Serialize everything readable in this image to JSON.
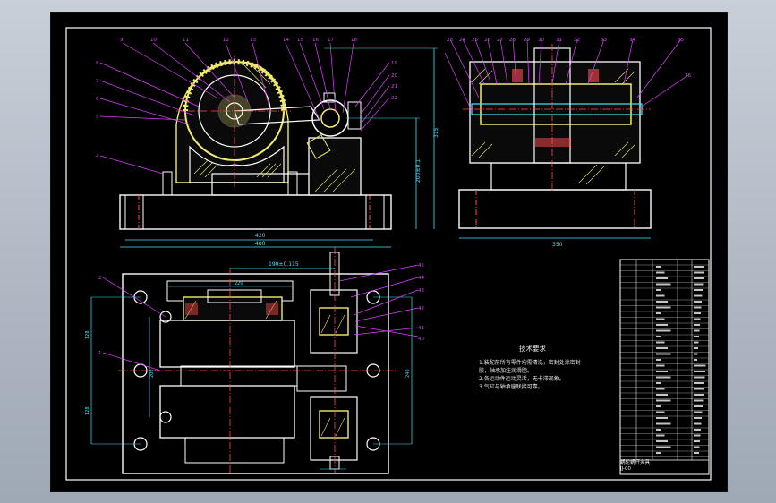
{
  "dimensions": {
    "front_view": {
      "width_inner": "420",
      "width_outer": "480",
      "height_total": "315",
      "height_center": "200±0.1"
    },
    "side_view": {
      "width": "350"
    },
    "top_view": {
      "center_distance": "190±0.115",
      "top_small": "220",
      "left_upper": "128",
      "left_mid": "200",
      "left_lower": "128",
      "right_total": "240"
    }
  },
  "balloons": {
    "front_top": [
      "9",
      "10",
      "11",
      "12",
      "13",
      "14",
      "15",
      "16",
      "17",
      "18"
    ],
    "front_right": [
      "19",
      "20",
      "21",
      "22"
    ],
    "front_left": [
      "8",
      "7",
      "6",
      "5",
      "4"
    ],
    "side_top": [
      "23",
      "24",
      "25",
      "26",
      "27",
      "28",
      "29",
      "30",
      "31",
      "32",
      "33",
      "34",
      "35",
      "36"
    ],
    "top_view_left": [
      "2",
      "1"
    ],
    "top_view_right": [
      "45",
      "44",
      "43",
      "42",
      "41",
      "40"
    ]
  },
  "notes": {
    "title": "技术要求",
    "lines": [
      "1.装配前所有零件均需清洗，密封处涂密封",
      "  胶，轴承加注润滑脂。",
      "2.各运动件运动灵活，无卡滞现象。",
      "3.气缸与轴承座联接可靠。"
    ]
  },
  "title_block": {
    "name": "蜗轮蜗杆夹具",
    "drawing_no": "JJ-00",
    "scale": "1:2"
  },
  "colors": {
    "frame": "#ffffff",
    "part_outline": "#f2ec6e",
    "center_line": "#ff4d4d",
    "dimension": "#41e6ff",
    "leader": "#e040ff",
    "body": "#ffffff"
  }
}
